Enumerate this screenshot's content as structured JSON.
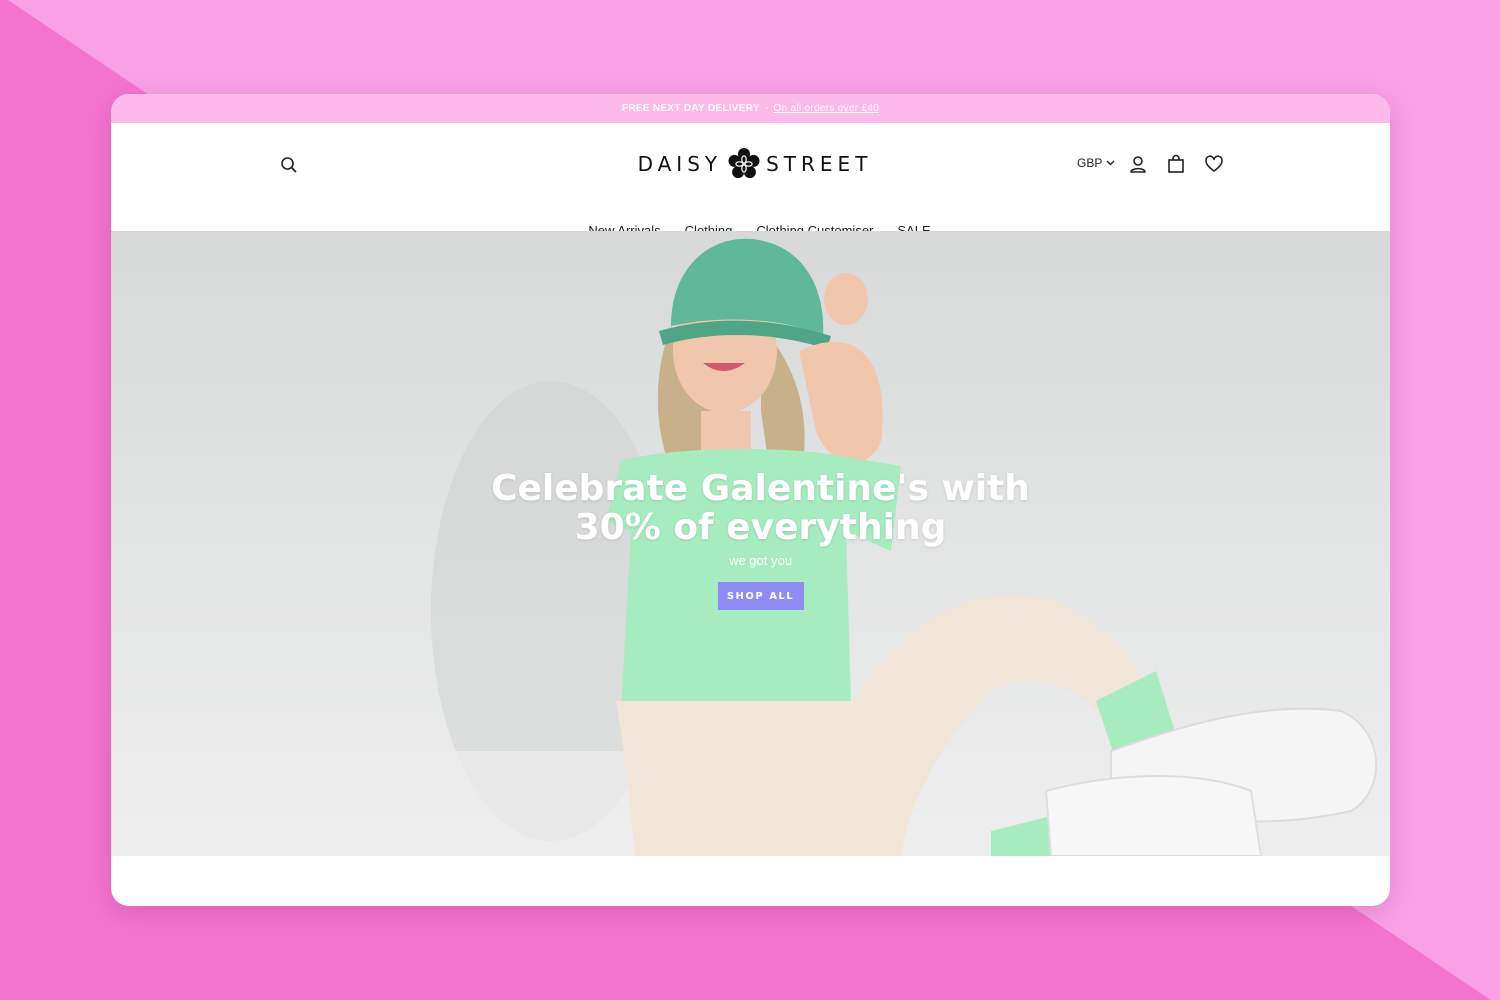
{
  "announcement": {
    "strong": "FREE NEXT DAY DELIVERY",
    "separator": "-",
    "link": "On all orders over £40"
  },
  "header": {
    "logo_left": "DAISY",
    "logo_right": "STREET",
    "currency": "GBP",
    "icons": [
      "search-icon",
      "account-icon",
      "bag-icon",
      "wishlist-heart-icon"
    ]
  },
  "nav": {
    "items": [
      "New Arrivals",
      "Clothing",
      "Clothing Customiser",
      "SALE"
    ]
  },
  "hero": {
    "headline_line1": "Celebrate Galentine's with",
    "headline_line2": "30% of everything",
    "subline": "we got you",
    "cta": "SHOP ALL"
  },
  "colors": {
    "background": "#f9a0e7",
    "background_diagonal": "#f373cf",
    "announcement_bar": "#fdb9ea",
    "cta_button": "#8d8cf4",
    "tee": "#a7ecbf",
    "hat": "#5fb89a"
  }
}
